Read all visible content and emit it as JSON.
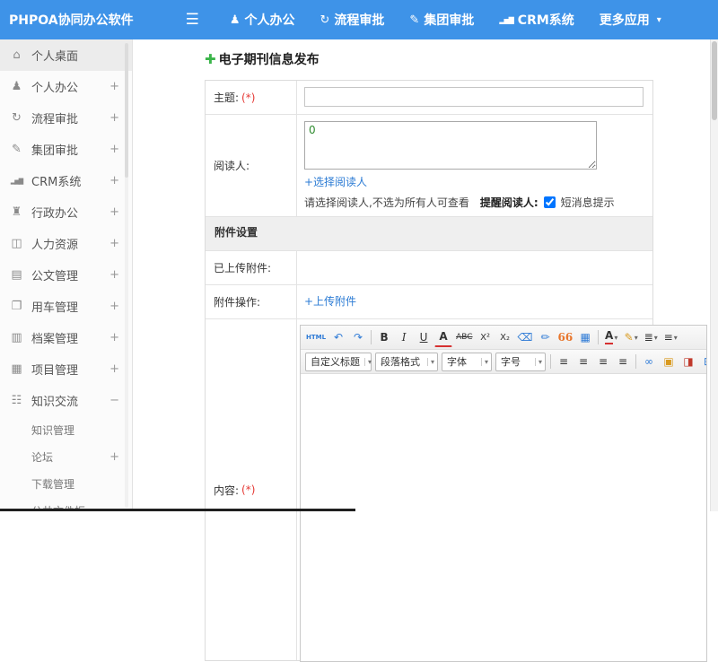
{
  "colors": {
    "topbar_blue": "#3E93E8",
    "link_blue": "#2B7BD4",
    "plus_green": "#3BB54A",
    "required_red": "#E53935"
  },
  "topbar": {
    "title": "PHPOA协同办公软件",
    "menu_icon": "☰",
    "more_caret": "▾",
    "nav": [
      {
        "icon": "♟",
        "label": "个人办公"
      },
      {
        "icon": "↻",
        "label": "流程审批"
      },
      {
        "icon": "✎",
        "label": "集团审批"
      },
      {
        "icon": "▂▅▇",
        "label": "CRM系统"
      },
      {
        "icon": "",
        "label": "更多应用"
      }
    ]
  },
  "sidebar": {
    "items": [
      {
        "icon": "⌂",
        "label": "个人桌面",
        "expand": ""
      },
      {
        "icon": "♟",
        "label": "个人办公",
        "expand": "+"
      },
      {
        "icon": "↻",
        "label": "流程审批",
        "expand": "+"
      },
      {
        "icon": "✎",
        "label": "集团审批",
        "expand": "+"
      },
      {
        "icon": "▂▅▇",
        "label": "CRM系统",
        "expand": "+"
      },
      {
        "icon": "♜",
        "label": "行政办公",
        "expand": "+"
      },
      {
        "icon": "◫",
        "label": "人力资源",
        "expand": "+"
      },
      {
        "icon": "▤",
        "label": "公文管理",
        "expand": "+"
      },
      {
        "icon": "❐",
        "label": "用车管理",
        "expand": "+"
      },
      {
        "icon": "▥",
        "label": "档案管理",
        "expand": "+"
      },
      {
        "icon": "▦",
        "label": "项目管理",
        "expand": "+"
      },
      {
        "icon": "☷",
        "label": "知识交流",
        "expand": "−"
      }
    ],
    "subitems": [
      {
        "label": "知识管理",
        "expand": ""
      },
      {
        "label": "论坛",
        "expand": "+"
      },
      {
        "label": "下载管理",
        "expand": ""
      },
      {
        "label": "公共文件柜",
        "expand": ""
      }
    ]
  },
  "main": {
    "plus_icon": "✚",
    "page_title": "电子期刊信息发布",
    "form": {
      "subject": {
        "label": "主题:",
        "required": "(*)"
      },
      "readers": {
        "label": "阅读人:",
        "value": "0",
        "select_link": "+选择阅读人",
        "hint": "请选择阅读人,不选为所有人可查看",
        "remind_label": "提醒阅读人:",
        "sms_checked": "checked",
        "sms_label": "短消息提示"
      },
      "attachment_header": "附件设置",
      "uploaded_label": "已上传附件:",
      "attach_op_label": "附件操作:",
      "upload_link": "+上传附件",
      "content": {
        "label": "内容:",
        "required": "(*)"
      }
    },
    "editor": {
      "caret": "▾",
      "row1": [
        "HTML",
        "↶",
        "↷",
        "B",
        "I",
        "U",
        "A",
        "ABC",
        "X²",
        "X₂",
        "⌫",
        "✏",
        "66",
        "▦",
        "A",
        "✎",
        "≣",
        "≡"
      ],
      "selects": [
        "自定义标题",
        "段落格式",
        "字体",
        "字号"
      ],
      "row2": [
        "≡",
        "≡",
        "≡",
        "≡",
        "∞",
        "▣",
        "◨",
        "⊞"
      ]
    }
  }
}
